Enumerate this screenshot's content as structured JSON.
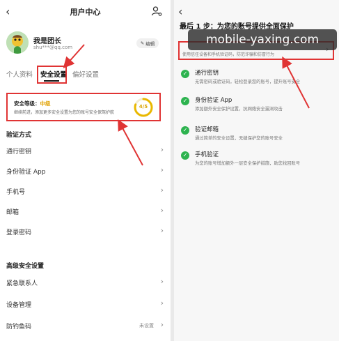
{
  "left": {
    "header_title": "用户中心",
    "user_name": "我是团长",
    "user_email": "shu***@qq.com",
    "edit_label": "编辑",
    "tabs": [
      "个人资料",
      "安全设置",
      "偏好设置"
    ],
    "security": {
      "level_prefix": "安全等级：",
      "level_value": "中级",
      "desc": "继续前进，添加更多安全设置为您的账号安全保驾护航",
      "score": "4/5",
      "progress": 0.8
    },
    "group1_title": "验证方式",
    "group1": [
      {
        "label": "通行密钥"
      },
      {
        "label": "身份验证 App"
      },
      {
        "label": "手机号"
      },
      {
        "label": "邮箱"
      },
      {
        "label": "登录密码"
      }
    ],
    "group2_title": "高级安全设置",
    "group2": [
      {
        "label": "紧急联系人",
        "value": ""
      },
      {
        "label": "设备管理",
        "value": ""
      },
      {
        "label": "防钓鱼码",
        "value": "未设置"
      }
    ]
  },
  "right": {
    "title": "最后 1 步：为您的账号提供全面保护",
    "watermark": "mobile-yaxing.com",
    "highlight_text": "使用信任设备和手机验证码，防范诈骗和仿冒行为",
    "items": [
      {
        "title": "通行密钥",
        "desc": "无需密码或验证码，轻松登录您的账号，提升账号安全"
      },
      {
        "title": "身份验证 App",
        "desc": "添加额外安全保护设置，抗网络安全漏洞攻击"
      },
      {
        "title": "验证邮箱",
        "desc": "通过简单的安全设置，无缝保护您的账号安全"
      },
      {
        "title": "手机验证",
        "desc": "为您的账号增加额外一层安全保护措施，助您找回账号"
      }
    ]
  },
  "colors": {
    "highlight_red": "#e03434",
    "success_green": "#2db34f",
    "level_gold": "#e0a100"
  }
}
